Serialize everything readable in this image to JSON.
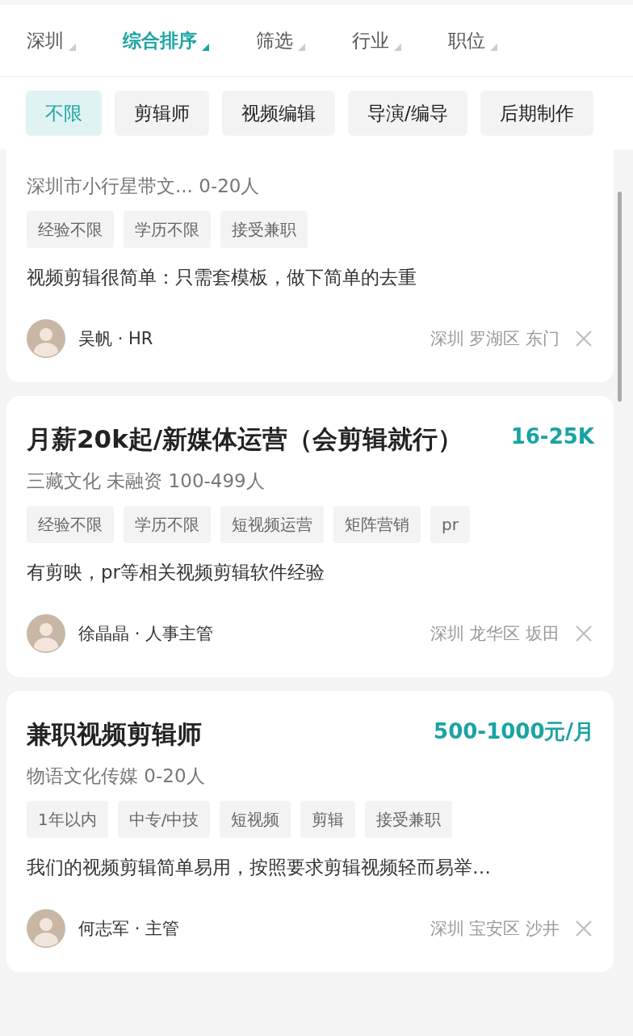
{
  "filters": [
    {
      "label": "深圳",
      "selected": false
    },
    {
      "label": "综合排序",
      "selected": true
    },
    {
      "label": "筛选",
      "selected": false
    },
    {
      "label": "行业",
      "selected": false
    },
    {
      "label": "职位",
      "selected": false
    }
  ],
  "categories": [
    {
      "label": "不限",
      "selected": true
    },
    {
      "label": "剪辑师",
      "selected": false
    },
    {
      "label": "视频编辑",
      "selected": false
    },
    {
      "label": "导演/编导",
      "selected": false
    },
    {
      "label": "后期制作",
      "selected": false
    }
  ],
  "jobs": [
    {
      "company": "深圳市小行星带文... 0-20人",
      "tags": [
        "经验不限",
        "学历不限",
        "接受兼职"
      ],
      "description": "视频剪辑很简单：只需套模板，做下简单的去重",
      "recruiter": "吴帆 · HR",
      "location": "深圳 罗湖区 东门"
    },
    {
      "title": "月薪20k起/新媒体运营（会剪辑就行）",
      "salary": "16-25K",
      "company": "三藏文化 未融资 100-499人",
      "tags": [
        "经验不限",
        "学历不限",
        "短视频运营",
        "矩阵营销",
        "pr"
      ],
      "description": "有剪映，pr等相关视频剪辑软件经验",
      "recruiter": "徐晶晶 · 人事主管",
      "location": "深圳 龙华区 坂田"
    },
    {
      "title": "兼职视频剪辑师",
      "salary": "500-1000元/月",
      "company": "物语文化传媒 0-20人",
      "tags": [
        "1年以内",
        "中专/中技",
        "短视频",
        "剪辑",
        "接受兼职"
      ],
      "description": "我们的视频剪辑简单易用，按照要求剪辑视频轻而易举…",
      "recruiter": "何志军 · 主管",
      "location": "深圳 宝安区 沙井"
    }
  ]
}
